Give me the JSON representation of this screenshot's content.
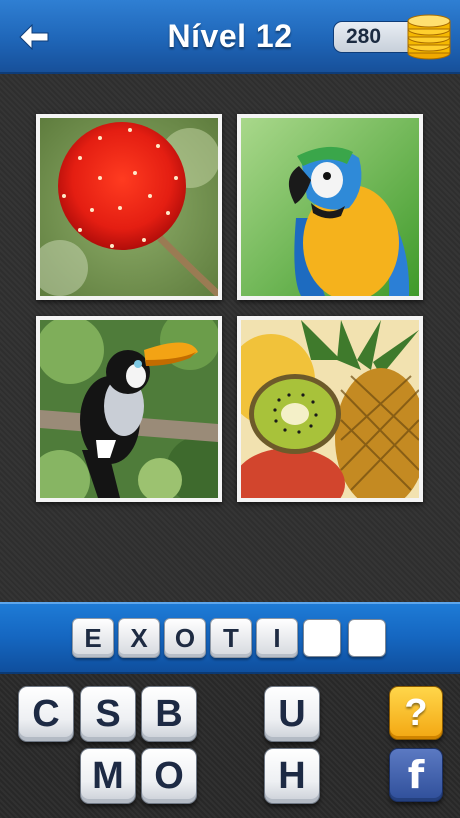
{
  "header": {
    "title": "Nível 12",
    "coins": "280",
    "back_icon": "back-arrow-icon",
    "coin_icon": "coin-stack-icon"
  },
  "photos": [
    {
      "subject": "red exotic flower"
    },
    {
      "subject": "blue-and-yellow macaw"
    },
    {
      "subject": "toucan on branch"
    },
    {
      "subject": "kiwi, pineapple and tropical fruits"
    }
  ],
  "answer": {
    "letters": [
      "E",
      "X",
      "O",
      "T",
      "I",
      "",
      ""
    ]
  },
  "keyboard": {
    "row1": [
      "C",
      "S",
      "B",
      "",
      "U"
    ],
    "row2": [
      "",
      "M",
      "O",
      "",
      "H"
    ]
  },
  "actions": {
    "hint_label": "?",
    "facebook_label": "f"
  },
  "colors": {
    "header_blue": "#1f66b8",
    "hint_yellow": "#f3a712",
    "facebook_blue": "#3b5998"
  }
}
